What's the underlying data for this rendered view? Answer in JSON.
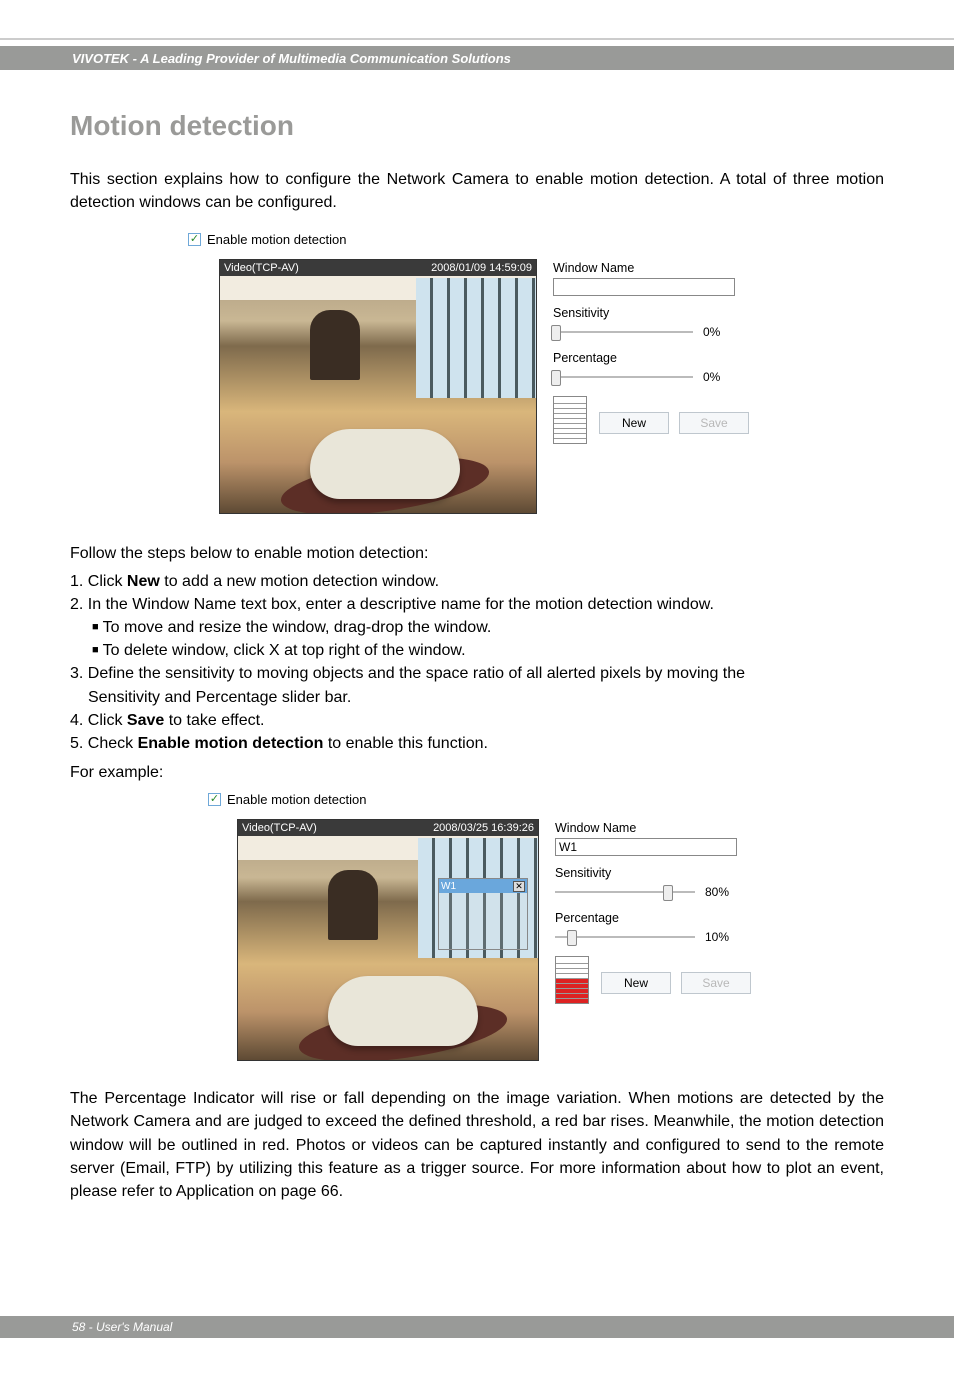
{
  "header": {
    "brand": "VIVOTEK - A Leading Provider of Multimedia Communication Solutions"
  },
  "title": "Motion detection",
  "intro": "This section explains how to configure the Network Camera to enable motion detection. A total of three motion detection windows can be configured.",
  "enable_label": "Enable motion detection",
  "panel1": {
    "stream": "Video(TCP-AV)",
    "timestamp": "2008/01/09 14:59:09",
    "window_name_label": "Window Name",
    "window_name_value": "",
    "sensitivity_label": "Sensitivity",
    "sensitivity_value": "0%",
    "percentage_label": "Percentage",
    "percentage_value": "0%",
    "new_btn": "New",
    "save_btn": "Save"
  },
  "follow": "Follow the steps below to enable motion detection:",
  "steps": {
    "s1a": "1. Click ",
    "s1b": "New",
    "s1c": " to add a new motion detection window.",
    "s2": "2. In the Window Name text box, enter a descriptive name for the motion detection window.",
    "s2a": "To move and resize the window, drag-drop the window.",
    "s2b": "To delete window, click X at top right of the window.",
    "s3": "3. Define the sensitivity to moving objects and the space ratio of all alerted pixels by moving the",
    "s3b": "Sensitivity and Percentage slider bar.",
    "s4a": "4. Click ",
    "s4b": "Save",
    "s4c": " to take effect.",
    "s5a": "5. Check ",
    "s5b": "Enable motion detection",
    "s5c": " to enable this function."
  },
  "forexample": "For example:",
  "panel2": {
    "stream": "Video(TCP-AV)",
    "timestamp": "2008/03/25 16:39:26",
    "md_label": "W1",
    "md_close": "✕",
    "window_name_label": "Window Name",
    "window_name_value": "W1",
    "sensitivity_label": "Sensitivity",
    "sensitivity_value": "80%",
    "percentage_label": "Percentage",
    "percentage_value": "10%",
    "new_btn": "New",
    "save_btn": "Save"
  },
  "final": "The Percentage Indicator will rise or fall depending on the image variation. When motions are detected by the Network Camera and are judged to exceed the defined threshold, a red bar rises. Meanwhile, the motion detection window will be outlined in red. Photos or videos can be captured instantly and configured to send to the remote server (Email, FTP) by utilizing this feature as a trigger source. For more information about how to plot an event, please refer to Application on page 66.",
  "footer": {
    "page": "58 - User's Manual"
  }
}
